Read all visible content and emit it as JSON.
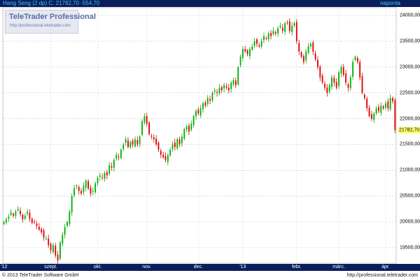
{
  "header": {
    "instrument_info": "Hang Seng (2 dp)  C: 21782,70  -554,70",
    "period": "naponta"
  },
  "watermark": {
    "brand": "TeleTrader Professional",
    "url": "http://professional.teletrader.com"
  },
  "footer": {
    "copyright": "© 2013 TeleTrader Software GmbH",
    "url": "http://professional.teletrader.com"
  },
  "colors": {
    "header_bg": "#0a1e5c",
    "header_text": "#3cc8ff",
    "up_candle": "#00b000",
    "down_candle": "#e00000",
    "last_price_bg": "#ffff66"
  },
  "chart_data": {
    "type": "candlestick",
    "interval": "daily",
    "last_price_label": "21782,70",
    "ylim": [
      19200,
      24150
    ],
    "yticks": [
      {
        "value": 19500,
        "label": "19500,00"
      },
      {
        "value": 20000,
        "label": "20000,00"
      },
      {
        "value": 20500,
        "label": "20500,00"
      },
      {
        "value": 21000,
        "label": "21000,00"
      },
      {
        "value": 21500,
        "label": "21500,00"
      },
      {
        "value": 22000,
        "label": "22000,00"
      },
      {
        "value": 22500,
        "label": "22500,00"
      },
      {
        "value": 23000,
        "label": "23000,00"
      },
      {
        "value": 23500,
        "label": "23500,00"
      },
      {
        "value": 24000,
        "label": "24000,00"
      }
    ],
    "xticks": [
      {
        "label": "'12",
        "index": 0
      },
      {
        "label": "szept.",
        "index": 20
      },
      {
        "label": "okt.",
        "index": 40
      },
      {
        "label": "nov.",
        "index": 61
      },
      {
        "label": "dec.",
        "index": 83
      },
      {
        "label": "'13",
        "index": 102
      },
      {
        "label": "febr.",
        "index": 125
      },
      {
        "label": "márc.",
        "index": 143
      },
      {
        "label": "ápr.",
        "index": 163
      }
    ],
    "grid": true,
    "x_count": 168,
    "closes": [
      20000,
      20050,
      20100,
      20180,
      20120,
      20200,
      20250,
      20150,
      20050,
      20120,
      20200,
      20060,
      19980,
      20000,
      19920,
      19850,
      19800,
      19700,
      19680,
      19550,
      19450,
      19550,
      19350,
      19250,
      19600,
      19750,
      19900,
      20000,
      20200,
      20500,
      20650,
      20700,
      20600,
      20550,
      20700,
      20800,
      20650,
      20550,
      20600,
      20750,
      20850,
      20900,
      20850,
      20950,
      20900,
      21100,
      21050,
      21200,
      21300,
      21250,
      21400,
      21500,
      21600,
      21450,
      21550,
      21500,
      21600,
      21500,
      21650,
      21950,
      22050,
      21900,
      21700,
      21650,
      21600,
      21500,
      21400,
      21300,
      21250,
      21200,
      21300,
      21400,
      21500,
      21450,
      21600,
      21500,
      21650,
      21800,
      21850,
      21750,
      21900,
      22050,
      22150,
      22100,
      22200,
      22300,
      22250,
      22400,
      22350,
      22500,
      22550,
      22500,
      22600,
      22550,
      22650,
      22600,
      22550,
      22700,
      22750,
      22650,
      23000,
      23200,
      23350,
      23300,
      23250,
      23350,
      23400,
      23500,
      23450,
      23400,
      23500,
      23600,
      23550,
      23650,
      23600,
      23700,
      23650,
      23750,
      23800,
      23700,
      23850,
      23850,
      23700,
      23800,
      23850,
      23500,
      23300,
      23200,
      23100,
      23300,
      23400,
      23450,
      23300,
      23150,
      23000,
      22800,
      22700,
      22600,
      22500,
      22650,
      22800,
      22700,
      22600,
      22900,
      23000,
      22850,
      22700,
      22600,
      22800,
      23100,
      23200,
      23100,
      22800,
      22500,
      22400,
      22200,
      22050,
      22000,
      22100,
      22200,
      22150,
      22250,
      22200,
      22300,
      22200,
      22400,
      22337,
      21783
    ]
  }
}
